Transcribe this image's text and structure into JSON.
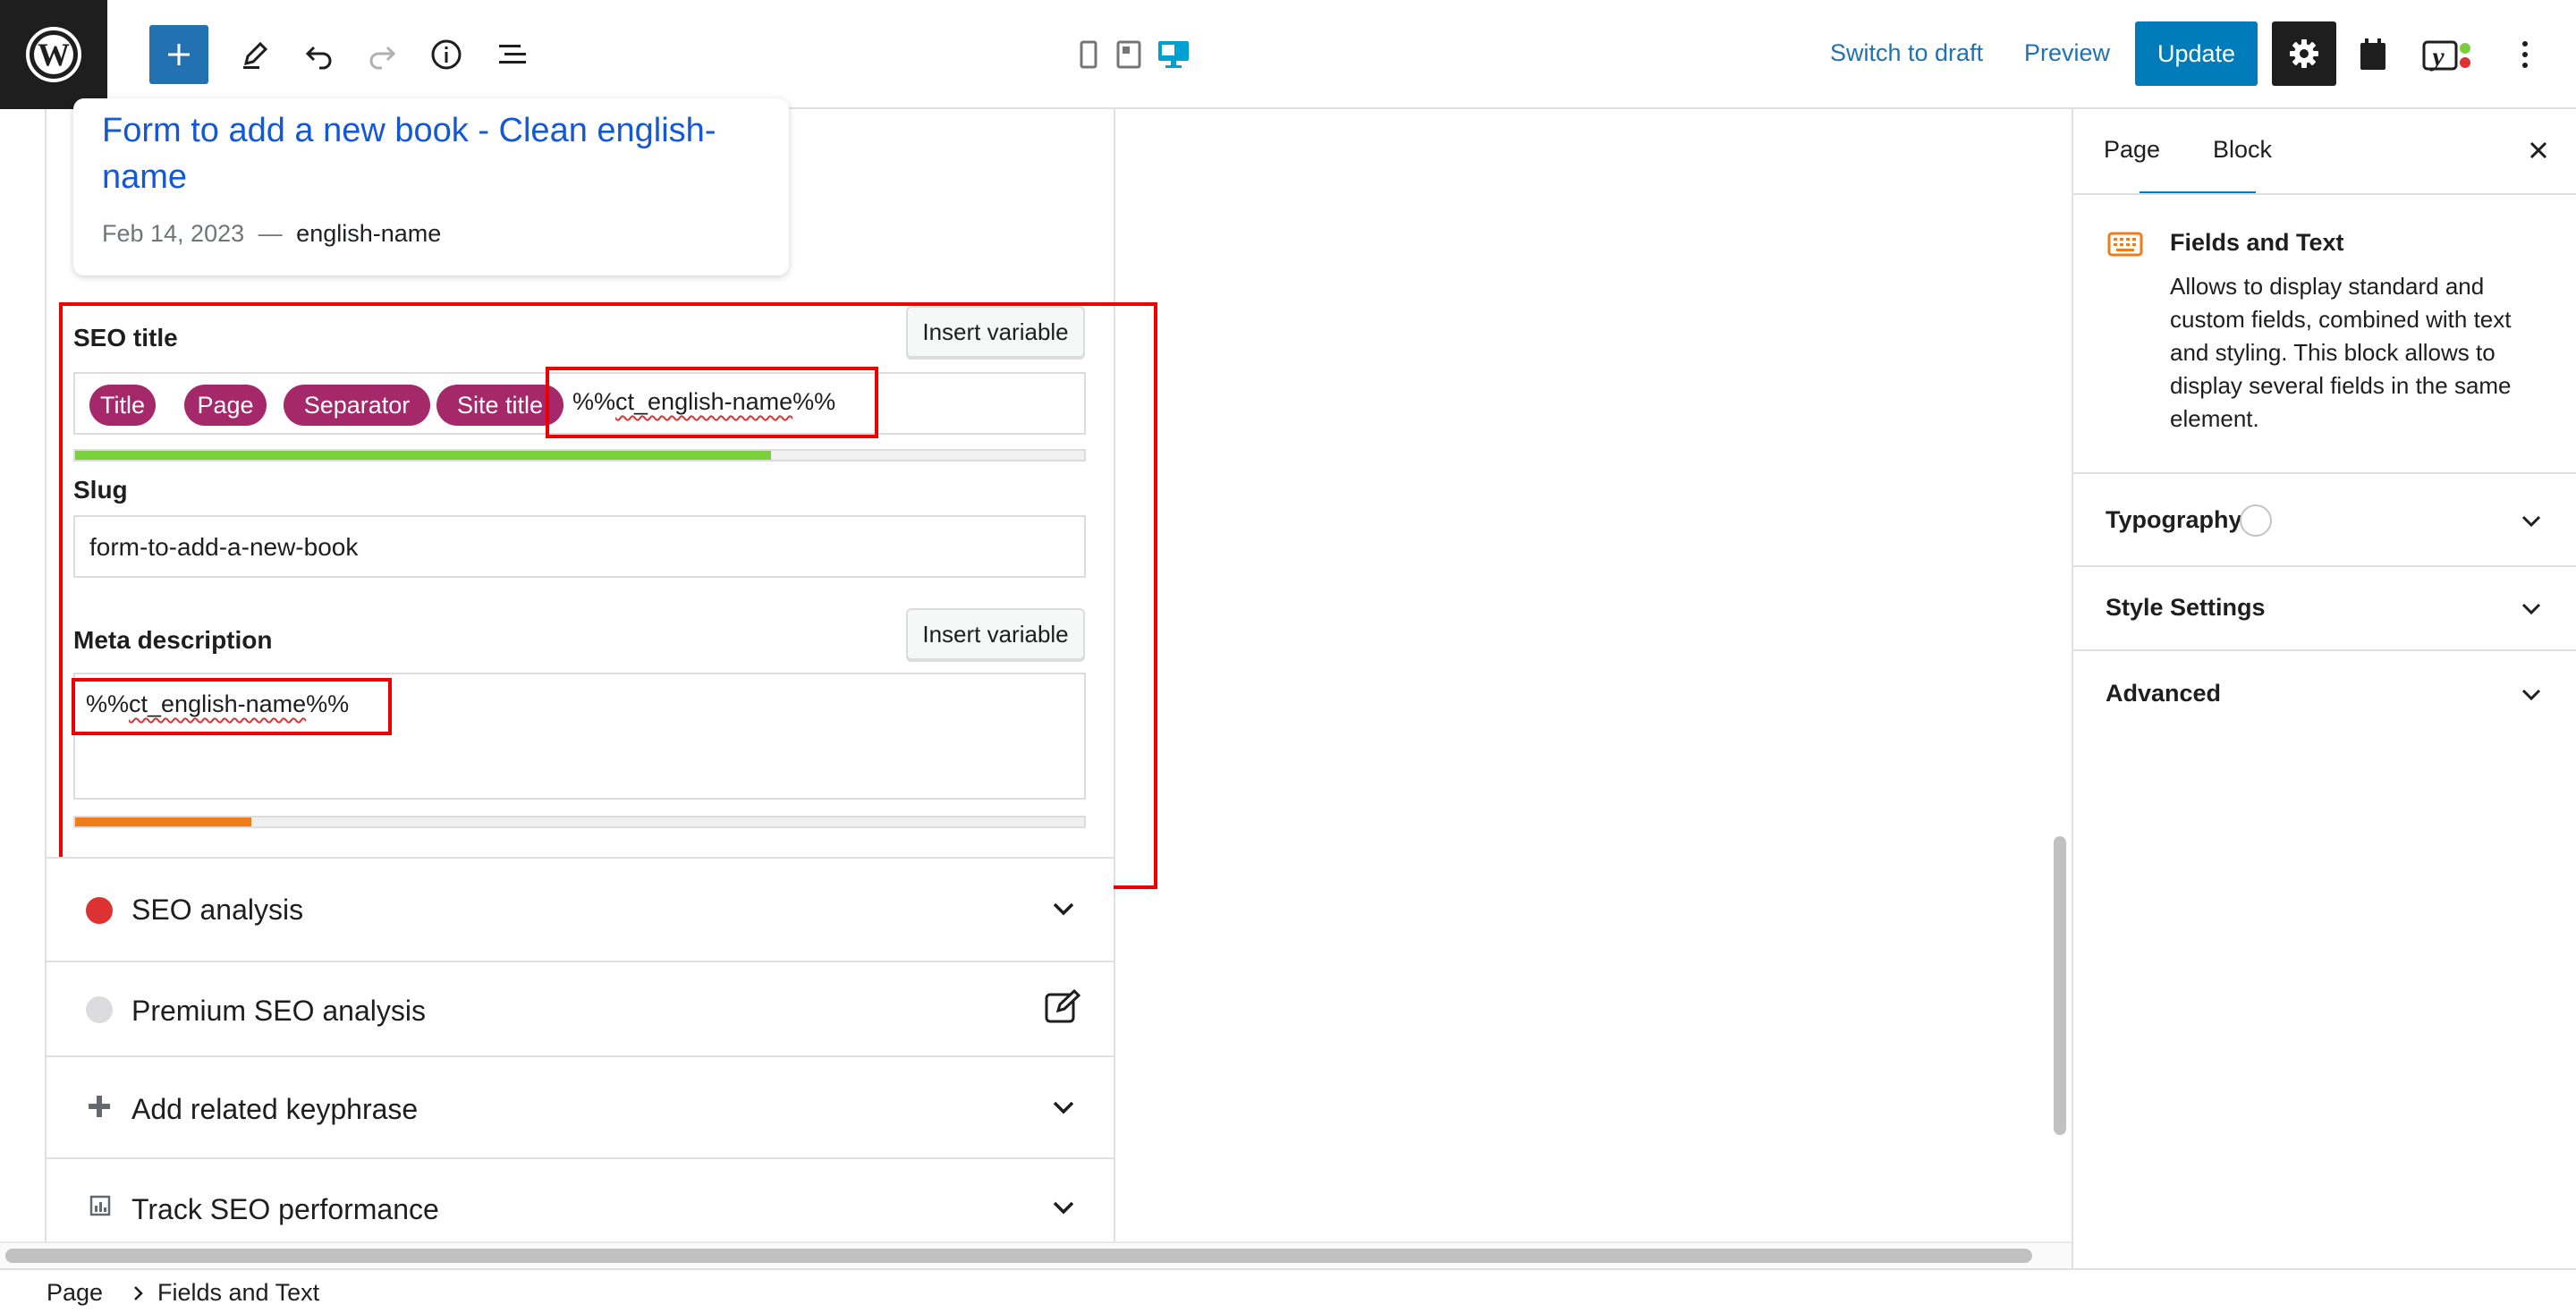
{
  "topbar": {
    "switch_to_draft": "Switch to draft",
    "preview": "Preview",
    "update": "Update",
    "icons": [
      "wordpress-logo-icon",
      "plus-icon",
      "pencil-icon",
      "undo-icon",
      "redo-icon",
      "info-icon",
      "list-view-icon",
      "mobile-icon",
      "tablet-icon",
      "desktop-icon",
      "gear-icon",
      "calendar-icon",
      "yoast-icon",
      "more-vertical-icon"
    ]
  },
  "preview_card": {
    "title": "Form to add a new book - Clean english-name",
    "date": "Feb 14, 2023",
    "separator": "—",
    "slug": "english-name"
  },
  "seo": {
    "seo_title_label": "SEO title",
    "insert_variable": "Insert variable",
    "chips": [
      "Title",
      "Page",
      "Separator",
      "Site title"
    ],
    "seo_title_variable": "%%ct_english-name%%",
    "title_progress": 0.69,
    "slug_label": "Slug",
    "slug_value": "form-to-add-a-new-book",
    "meta_label": "Meta description",
    "meta_value": "%%ct_english-name%%",
    "meta_progress": 0.175,
    "colors": {
      "chip": "#a4286a",
      "good": "#7ad03a",
      "ok": "#ee7c1b",
      "highlight": "#ee0000"
    }
  },
  "accordions": [
    {
      "label": "SEO analysis",
      "icon": "red-dot-icon"
    },
    {
      "label": "Premium SEO analysis",
      "icon": "gray-dot-icon"
    },
    {
      "label": "Add related keyphrase",
      "icon": "plus-icon"
    },
    {
      "label": "Track SEO performance",
      "icon": "chart-icon"
    }
  ],
  "sidebar": {
    "tab_page": "Page",
    "tab_block": "Block",
    "block_name": "Fields and Text",
    "block_description": "Allows to display standard and custom fields, combined with text and styling. This block allows to display several fields in the same element.",
    "sections": [
      "Typography",
      "Style Settings",
      "Advanced"
    ]
  },
  "breadcrumb": {
    "root": "Page",
    "current": "Fields and Text"
  }
}
